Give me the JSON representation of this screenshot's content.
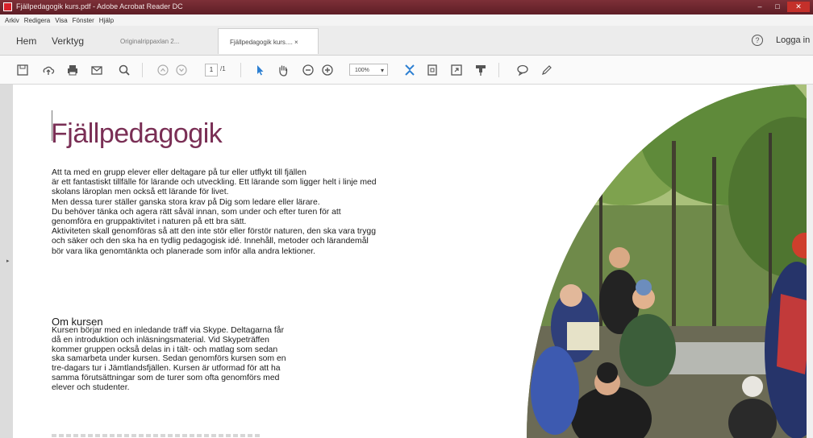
{
  "window": {
    "title": "Fjällpedagogik kurs.pdf - Adobe Acrobat Reader DC"
  },
  "menu": [
    "Arkiv",
    "Redigera",
    "Visa",
    "Fönster",
    "Hjälp"
  ],
  "nav": {
    "home": "Hem",
    "tools": "Verktyg"
  },
  "tabs": [
    {
      "label": "Originalrippaxlan 2...",
      "active": false
    },
    {
      "label": "Fjällpedagogik kurs.... ×",
      "active": true
    }
  ],
  "help_glyph": "?",
  "login": "Logga in",
  "toolbar": {
    "page_current": "1",
    "page_total": "/1",
    "zoom": "100%",
    "icons": [
      "save-icon",
      "upload-icon",
      "print-icon",
      "mail-icon",
      "search-icon",
      "prev-page-icon",
      "next-page-icon",
      "select-arrow-icon",
      "hand-icon",
      "zoom-out-icon",
      "zoom-in-icon",
      "fit-page-icon",
      "page-view-icon",
      "scroll-mode-icon",
      "stamp-icon",
      "comment-icon",
      "pen-icon"
    ]
  },
  "document": {
    "title": "Fjällpedagogik",
    "intro": [
      "Att ta med en grupp elever eller deltagare på tur eller utflykt till fjällen",
      "är ett fantastiskt tillfälle för lärande och utveckling. Ett lärande som ligger helt i linje med",
      "skolans läroplan men också ett lärande för livet.",
      "Men dessa turer ställer ganska stora krav på Dig som ledare eller lärare.",
      "Du behöver tänka och agera rätt såväl innan, som under och efter turen för att",
      "genomföra en gruppaktivitet i naturen på ett bra sätt.",
      "Aktiviteten skall genomföras så att den inte stör eller förstör naturen, den ska vara trygg",
      "och säker och den ska ha en tydlig pedagogisk idé. Innehåll, metoder och lärandemål",
      "bör vara lika genomtänkta och planerade som inför alla andra lektioner."
    ],
    "section_heading": "Om kursen",
    "section_body": [
      "Kursen börjar med en inledande träff via Skype. Deltagarna får",
      "då en introduktion och  inläsningsmaterial. Vid Skypeträffen",
      "kommer gruppen också delas in i tält- och matlag som sedan",
      "ska samarbeta under kursen. Sedan genomförs kursen som en",
      "tre-dagars tur i Jämtlandsfjällen. Kursen är utformad för att ha",
      "samma förutsättningar som de turer som ofta genomförs med",
      "elever och studenter."
    ]
  },
  "colors": {
    "title_bar": "#6a242c",
    "doc_title": "#7a2f55",
    "accent_blue": "#2c7fd2"
  }
}
